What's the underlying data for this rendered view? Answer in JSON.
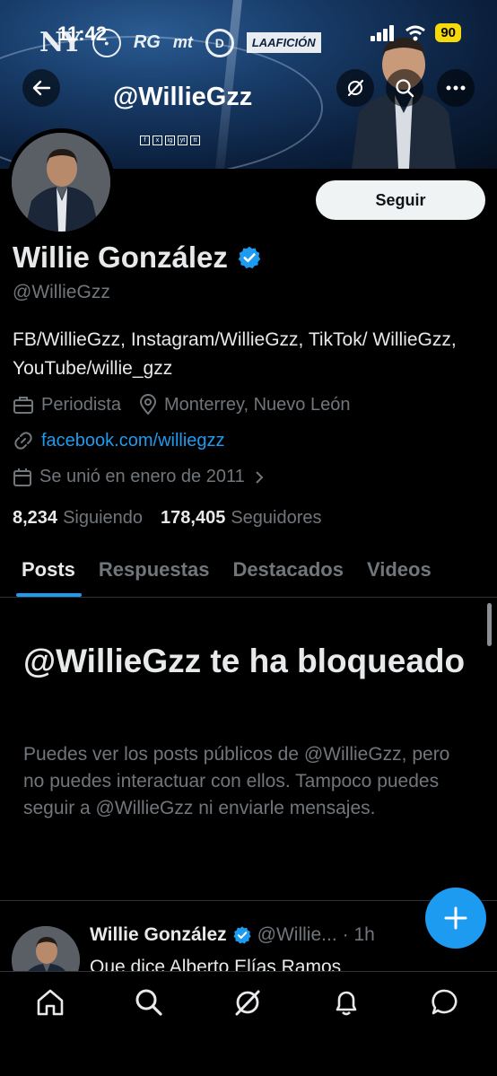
{
  "status_bar": {
    "time": "11:42",
    "battery": "90"
  },
  "banner": {
    "handle": "@WillieGzz",
    "logos": [
      "NY",
      "RG",
      "mt",
      "D",
      "LAAFICIÓN"
    ],
    "social_icons": [
      "f",
      "x",
      "ig",
      "yt",
      "tt"
    ]
  },
  "header": {
    "back_icon": "arrow-left-icon",
    "grok_icon": "grok-icon",
    "search_icon": "search-icon",
    "more_icon": "more-icon"
  },
  "profile": {
    "follow_label": "Seguir",
    "display_name": "Willie González",
    "verified": true,
    "username": "@WillieGzz",
    "bio": "FB/WillieGzz, Instagram/WillieGzz, TikTok/ WillieGzz, YouTube/willie_gzz",
    "profession": "Periodista",
    "location": "Monterrey, Nuevo León",
    "website": "facebook.com/williegzz",
    "joined": "Se unió en enero de 2011",
    "following_count": "8,234",
    "following_label": "Siguiendo",
    "followers_count": "178,405",
    "followers_label": "Seguidores"
  },
  "tabs": [
    {
      "label": "Posts",
      "active": true
    },
    {
      "label": "Respuestas",
      "active": false
    },
    {
      "label": "Destacados",
      "active": false
    },
    {
      "label": "Videos",
      "active": false
    }
  ],
  "blocked": {
    "title": "@WillieGzz te ha bloqueado",
    "description": "Puedes ver los posts públicos de @WillieGzz, pero no puedes interactuar con ellos. Tampoco puedes seguir a @WillieGzz ni enviarle mensajes."
  },
  "post": {
    "name": "Willie González",
    "handle": "@Willie...",
    "time": "· 1h",
    "text": "Que dice Alberto Elías Ramos"
  },
  "fab": {
    "icon": "plus-icon"
  },
  "bottom_nav": [
    "home-icon",
    "search-icon",
    "grok-icon",
    "notifications-icon",
    "messages-icon"
  ],
  "colors": {
    "accent": "#1d9bf0",
    "background": "#000000",
    "muted": "#71767b",
    "text": "#e7e9ea",
    "battery": "#f5d90a"
  }
}
